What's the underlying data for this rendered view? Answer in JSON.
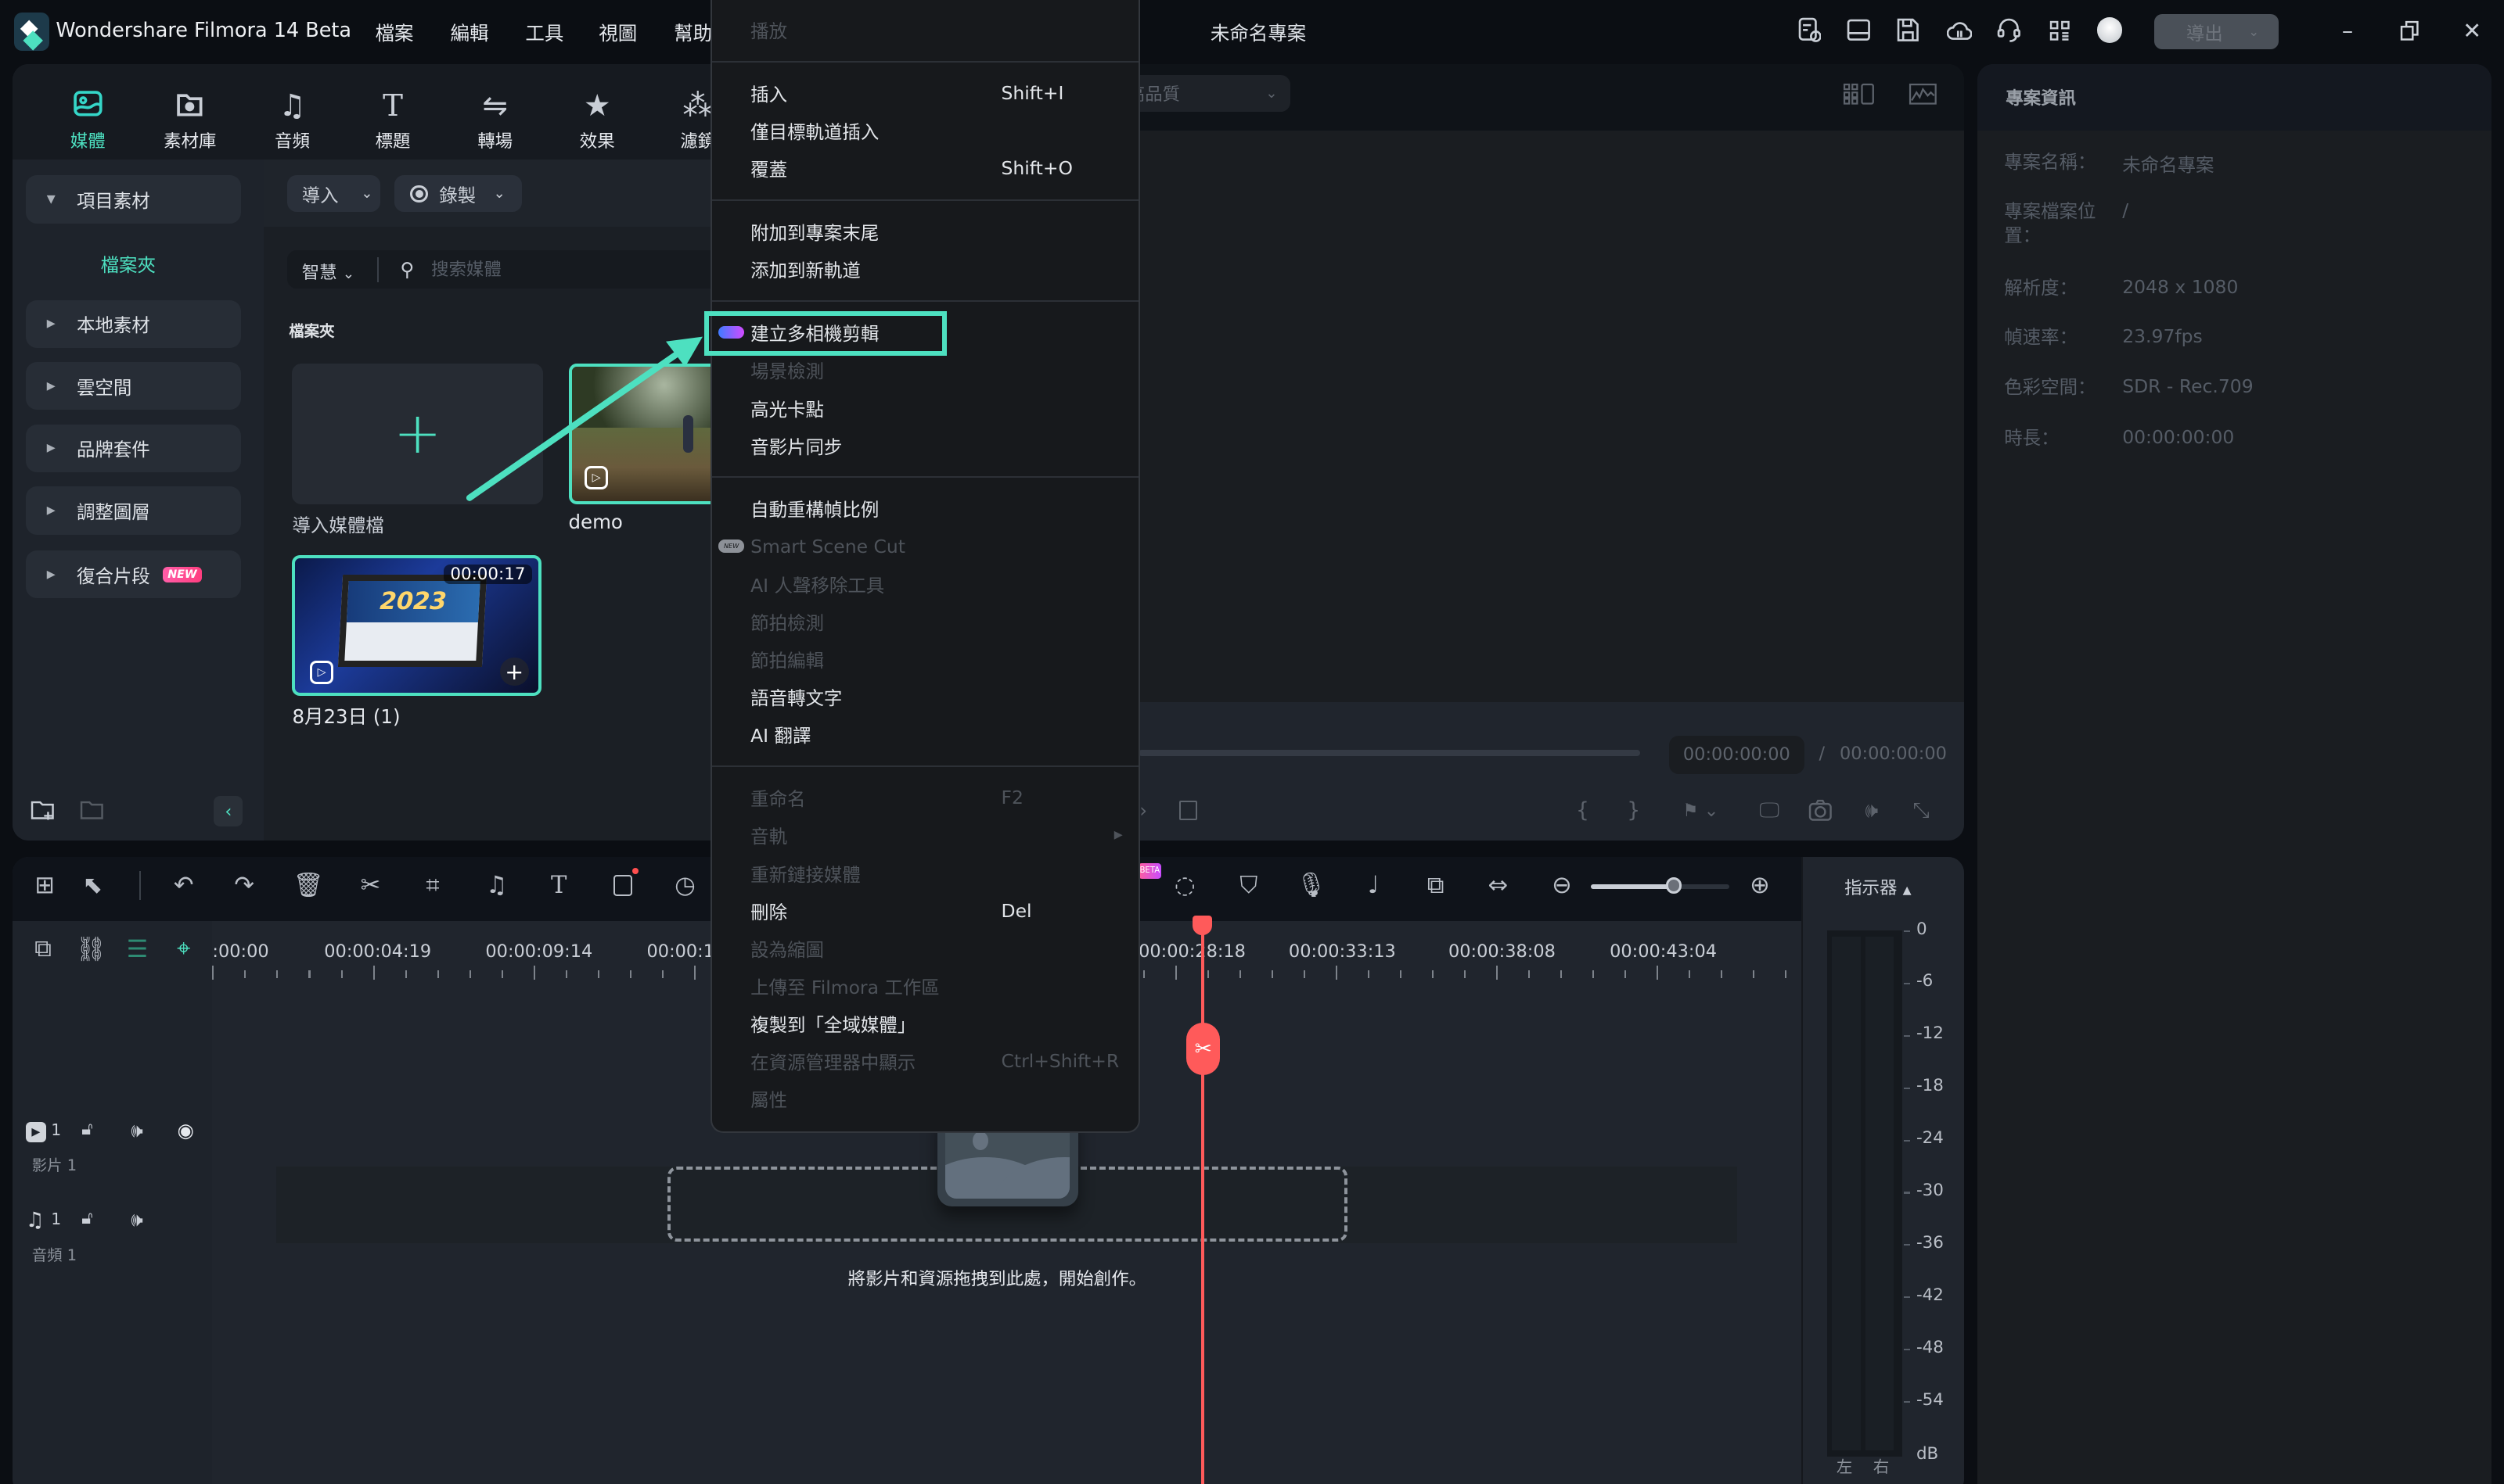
{
  "app": {
    "title": "Wondershare Filmora 14 Beta",
    "project_title": "未命名專案"
  },
  "menubar": [
    "檔案",
    "編輯",
    "工具",
    "視圖",
    "幫助"
  ],
  "topbar": {
    "export_label": "導出",
    "icons": [
      "task-list-icon",
      "layout-icon",
      "save-icon",
      "cloud-upload-icon",
      "headset-icon",
      "apps-grid-icon",
      "avatar"
    ]
  },
  "tabs": [
    {
      "label": "媒體",
      "icon": "media-icon",
      "active": true
    },
    {
      "label": "素材庫",
      "icon": "stock-icon"
    },
    {
      "label": "音頻",
      "icon": "music-icon"
    },
    {
      "label": "標題",
      "icon": "title-icon"
    },
    {
      "label": "轉場",
      "icon": "transition-icon"
    },
    {
      "label": "效果",
      "icon": "effects-icon"
    },
    {
      "label": "濾鏡",
      "icon": "filter-icon"
    }
  ],
  "sidebar": {
    "project_media": "項目素材",
    "folder": "檔案夾",
    "items": [
      "本地素材",
      "雲空間",
      "品牌套件",
      "調整圖層",
      "復合片段"
    ],
    "new_badge": "NEW"
  },
  "media": {
    "import_label": "導入",
    "record_label": "錄製",
    "smart_label": "智慧",
    "search_placeholder": "搜索媒體",
    "folder_heading": "檔案夾",
    "tiles": [
      {
        "label": "導入媒體檔"
      },
      {
        "label": "demo"
      },
      {
        "label": "8月23日 (1)",
        "duration": "00:00:17"
      }
    ]
  },
  "preview": {
    "quality": "高品質",
    "current_time": "00:00:00:00",
    "separator": "/",
    "total_time": "00:00:00:00"
  },
  "project_info": {
    "heading": "專案資訊",
    "rows": [
      {
        "label": "專案名稱：",
        "value": "未命名專案"
      },
      {
        "label": "專案檔案位置：",
        "value": "/"
      },
      {
        "label": "解析度：",
        "value": "2048 x 1080"
      },
      {
        "label": "幀速率：",
        "value": "23.97fps"
      },
      {
        "label": "色彩空間：",
        "value": "SDR - Rec.709"
      },
      {
        "label": "時長：",
        "value": "00:00:00:00"
      }
    ]
  },
  "context_menu": {
    "groups": [
      [
        {
          "label": "播放",
          "disabled": true
        }
      ],
      [
        {
          "label": "插入",
          "shortcut": "Shift+I"
        },
        {
          "label": "僅目標軌道插入"
        },
        {
          "label": "覆蓋",
          "shortcut": "Shift+O"
        }
      ],
      [
        {
          "label": "附加到專案末尾"
        },
        {
          "label": "添加到新軌道"
        }
      ],
      [
        {
          "label": "建立多相機剪輯",
          "highlighted": true,
          "badge": "multicam"
        },
        {
          "label": "場景檢測",
          "disabled": true
        },
        {
          "label": "高光卡點"
        },
        {
          "label": "音影片同步"
        }
      ],
      [
        {
          "label": "自動重構幀比例"
        },
        {
          "label": "Smart Scene Cut",
          "disabled": true,
          "badge": "new"
        },
        {
          "label": "AI 人聲移除工具",
          "disabled": true
        },
        {
          "label": "節拍檢測",
          "disabled": true
        },
        {
          "label": "節拍編輯",
          "disabled": true
        },
        {
          "label": "語音轉文字"
        },
        {
          "label": "AI 翻譯"
        }
      ],
      [
        {
          "label": "重命名",
          "shortcut": "F2",
          "disabled": true
        },
        {
          "label": "音軌",
          "disabled": true,
          "submenu": true
        },
        {
          "label": "重新鏈接媒體",
          "disabled": true
        },
        {
          "label": "刪除",
          "shortcut": "Del"
        },
        {
          "label": "設為縮圖",
          "disabled": true
        },
        {
          "label": "上傳至 Filmora 工作區",
          "disabled": true
        },
        {
          "label": "複製到「全域媒體」"
        },
        {
          "label": "在資源管理器中顯示",
          "shortcut": "Ctrl+Shift+R",
          "disabled": true
        },
        {
          "label": "屬性",
          "disabled": true
        }
      ]
    ],
    "new_badge": "NEW"
  },
  "timeline": {
    "ruler": [
      ":00:00",
      "00:00:04:19",
      "00:00:09:14",
      "00:00:1",
      "00:00:28:18",
      "00:00:33:13",
      "00:00:38:08",
      "00:00:43:04"
    ],
    "zoom_level": 0.6,
    "beta_badge": "BETA",
    "tracks": [
      {
        "index": "1",
        "label": "影片 1"
      },
      {
        "index": "1",
        "label": "音頻 1"
      }
    ],
    "drop_hint": "將影片和資源拖拽到此處，開始創作。",
    "meter_label": "指示器",
    "meter_scale": [
      "0",
      "-6",
      "-12",
      "-18",
      "-24",
      "-30",
      "-36",
      "-42",
      "-48",
      "-54"
    ],
    "meter_unit": "dB",
    "meter_channels": [
      "左",
      "右"
    ]
  },
  "colors": {
    "accent": "#4de0c0",
    "playhead": "#ff5a5a",
    "menu_bg": "#17191c"
  }
}
